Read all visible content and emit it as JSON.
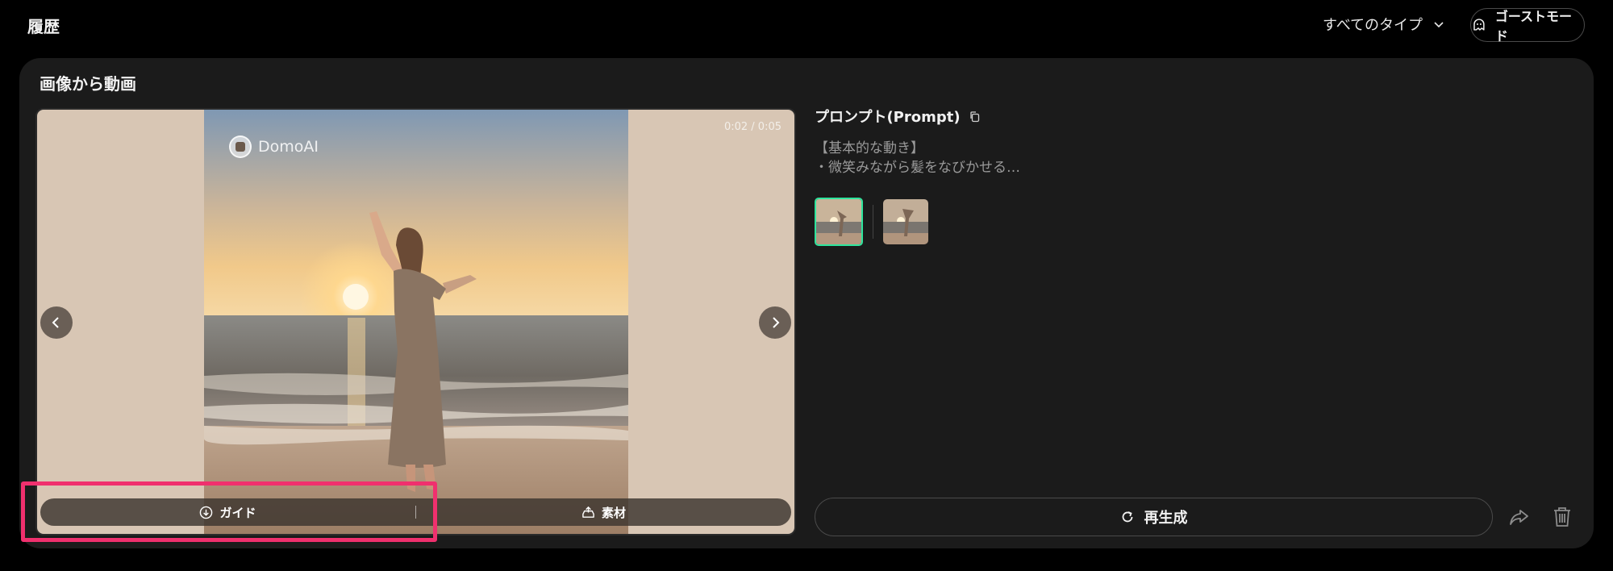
{
  "header": {
    "title": "履歴",
    "type_filter": "すべてのタイプ",
    "ghost_mode": "ゴーストモード"
  },
  "card": {
    "title": "画像から動画",
    "player": {
      "timecode": "0:02 / 0:05",
      "watermark": "DomoAI",
      "guide_label": "ガイド",
      "material_label": "素材"
    },
    "prompt": {
      "label": "プロンプト(Prompt)",
      "line1": "【基本的な動き】",
      "line2": "・微笑みながら髪をなびかせる…"
    },
    "regenerate_label": "再生成"
  },
  "colors": {
    "accent_green": "#2ee59d",
    "highlight": "#f0306e",
    "card_bg": "#1b1b1b"
  }
}
